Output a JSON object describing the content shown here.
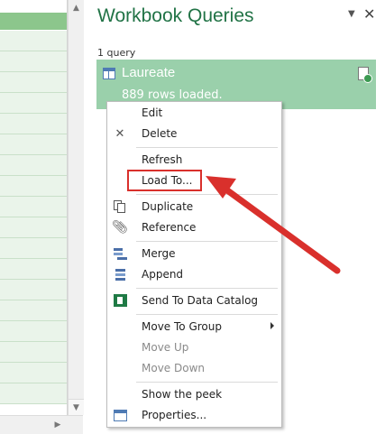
{
  "pane": {
    "title": "Workbook Queries",
    "query_count": "1 query",
    "query": {
      "name": "Laureate",
      "status": "889 rows loaded."
    }
  },
  "context_menu": {
    "edit": "Edit",
    "delete": "Delete",
    "refresh": "Refresh",
    "load_to": "Load To...",
    "duplicate": "Duplicate",
    "reference": "Reference",
    "merge": "Merge",
    "append": "Append",
    "send_to_data_catalog": "Send To Data Catalog",
    "move_to_group": "Move To Group",
    "move_up": "Move Up",
    "move_down": "Move Down",
    "show_the_peek": "Show the peek",
    "properties": "Properties..."
  },
  "colors": {
    "title_green": "#217346",
    "card_green": "#9ad0ab",
    "annotation_red": "#d9302c"
  },
  "icons": {
    "pane_dropdown": "chevron-down-icon",
    "pane_close": "close-icon",
    "query_table": "table-icon",
    "query_refresh": "refresh-icon",
    "delete": "x-icon",
    "duplicate": "duplicate-icon",
    "reference": "paperclip-icon",
    "merge": "merge-icon",
    "append": "append-icon",
    "send_to_data_catalog": "data-catalog-icon",
    "properties": "properties-icon"
  }
}
